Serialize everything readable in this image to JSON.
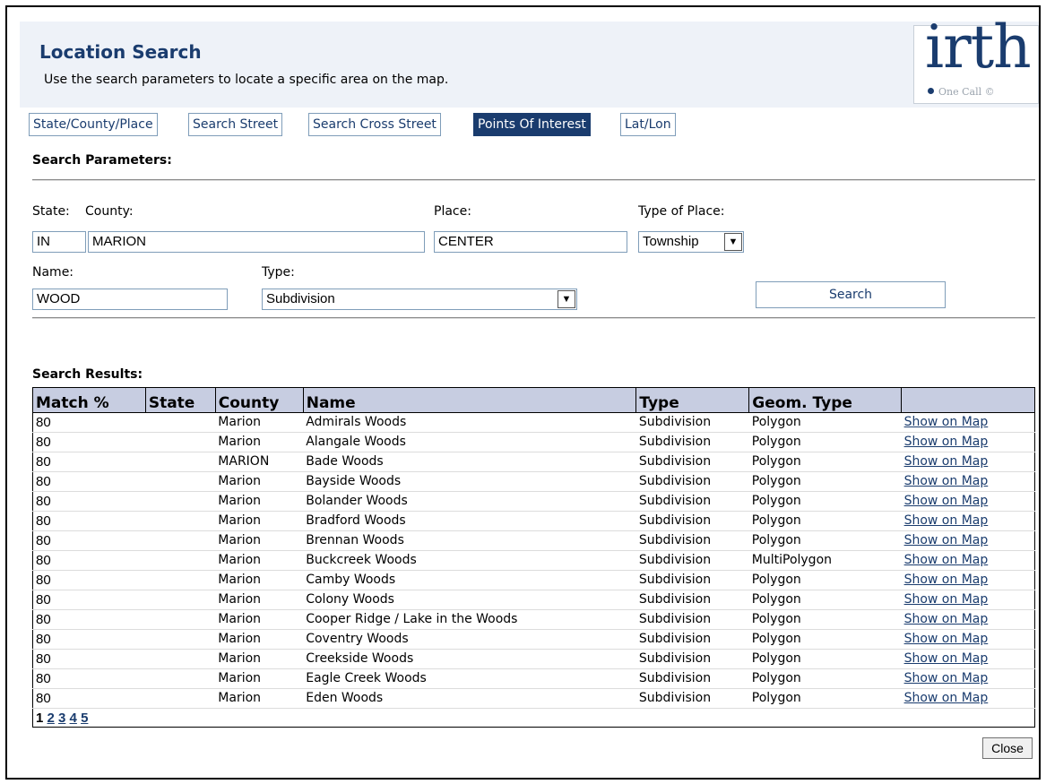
{
  "header": {
    "title": "Location Search",
    "subtitle": "Use the search parameters to locate a specific area on the map.",
    "logo_text": "irth",
    "logo_subtext": "One Call ©"
  },
  "tabs": [
    {
      "label": "State/County/Place",
      "active": false
    },
    {
      "label": "Search Street",
      "active": false
    },
    {
      "label": "Search Cross Street",
      "active": false
    },
    {
      "label": "Points Of Interest",
      "active": true
    },
    {
      "label": "Lat/Lon",
      "active": false
    }
  ],
  "params": {
    "section_title": "Search Parameters:",
    "state_label": "State:",
    "state_value": "IN",
    "county_label": "County:",
    "county_value": "MARION",
    "place_label": "Place:",
    "place_value": "CENTER",
    "place_type_label": "Type of Place:",
    "place_type_value": "Township",
    "name_label": "Name:",
    "name_value": "WOOD",
    "type_label": "Type:",
    "type_value": "Subdivision",
    "search_button": "Search"
  },
  "results": {
    "section_title": "Search Results:",
    "columns": [
      "Match %",
      "State",
      "County",
      "Name",
      "Type",
      "Geom. Type",
      ""
    ],
    "link_label": "Show on Map",
    "rows": [
      {
        "match": "80",
        "state": "",
        "county": "Marion",
        "name": "Admirals Woods",
        "type": "Subdivision",
        "geom": "Polygon"
      },
      {
        "match": "80",
        "state": "",
        "county": "Marion",
        "name": "Alangale Woods",
        "type": "Subdivision",
        "geom": "Polygon"
      },
      {
        "match": "80",
        "state": "",
        "county": "MARION",
        "name": "Bade Woods",
        "type": "Subdivision",
        "geom": "Polygon"
      },
      {
        "match": "80",
        "state": "",
        "county": "Marion",
        "name": "Bayside Woods",
        "type": "Subdivision",
        "geom": "Polygon"
      },
      {
        "match": "80",
        "state": "",
        "county": "Marion",
        "name": "Bolander Woods",
        "type": "Subdivision",
        "geom": "Polygon"
      },
      {
        "match": "80",
        "state": "",
        "county": "Marion",
        "name": "Bradford Woods",
        "type": "Subdivision",
        "geom": "Polygon"
      },
      {
        "match": "80",
        "state": "",
        "county": "Marion",
        "name": "Brennan Woods",
        "type": "Subdivision",
        "geom": "Polygon"
      },
      {
        "match": "80",
        "state": "",
        "county": "Marion",
        "name": "Buckcreek Woods",
        "type": "Subdivision",
        "geom": "MultiPolygon"
      },
      {
        "match": "80",
        "state": "",
        "county": "Marion",
        "name": "Camby Woods",
        "type": "Subdivision",
        "geom": "Polygon"
      },
      {
        "match": "80",
        "state": "",
        "county": "Marion",
        "name": "Colony Woods",
        "type": "Subdivision",
        "geom": "Polygon"
      },
      {
        "match": "80",
        "state": "",
        "county": "Marion",
        "name": "Cooper Ridge / Lake in the Woods",
        "type": "Subdivision",
        "geom": "Polygon"
      },
      {
        "match": "80",
        "state": "",
        "county": "Marion",
        "name": "Coventry Woods",
        "type": "Subdivision",
        "geom": "Polygon"
      },
      {
        "match": "80",
        "state": "",
        "county": "Marion",
        "name": "Creekside Woods",
        "type": "Subdivision",
        "geom": "Polygon"
      },
      {
        "match": "80",
        "state": "",
        "county": "Marion",
        "name": "Eagle Creek Woods",
        "type": "Subdivision",
        "geom": "Polygon"
      },
      {
        "match": "80",
        "state": "",
        "county": "Marion",
        "name": "Eden Woods",
        "type": "Subdivision",
        "geom": "Polygon"
      }
    ],
    "pages": [
      "1",
      "2",
      "3",
      "4",
      "5"
    ],
    "current_page": "1"
  },
  "footer": {
    "close_button": "Close"
  },
  "colors": {
    "accent": "#1a3c6e",
    "header_bg": "#eef2f8",
    "table_header_bg": "#c7cde1"
  }
}
